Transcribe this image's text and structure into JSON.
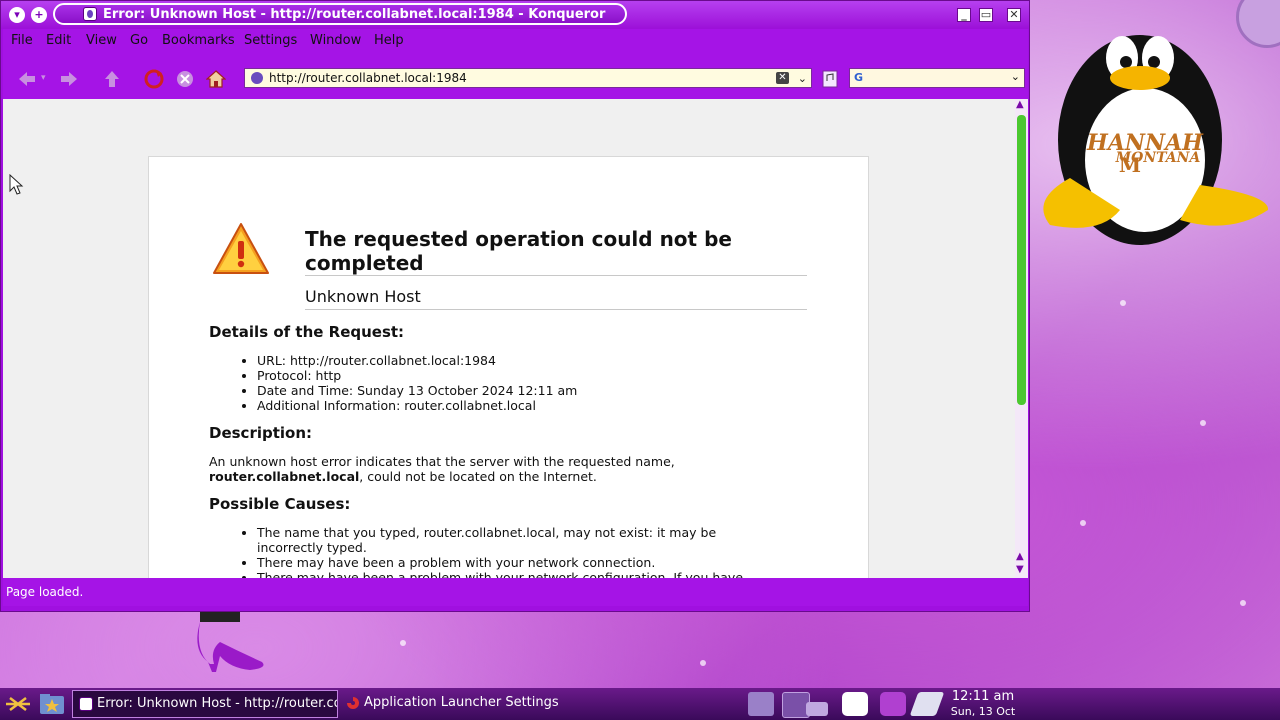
{
  "window": {
    "title": "Error: Unknown Host - http://router.collabnet.local:1984 - Konqueror"
  },
  "menubar": {
    "items": [
      "File",
      "Edit",
      "View",
      "Go",
      "Bookmarks",
      "Settings",
      "Window",
      "Help"
    ]
  },
  "toolbar": {
    "url": "http://router.collabnet.local:1984",
    "search_placeholder": ""
  },
  "page": {
    "heading": "The requested operation could not be completed",
    "subheading": "Unknown Host",
    "details_title": "Details of the Request:",
    "details": [
      "URL: http://router.collabnet.local:1984",
      "Protocol: http",
      "Date and Time: Sunday 13 October 2024 12:11 am",
      "Additional Information: router.collabnet.local"
    ],
    "description_title": "Description:",
    "description_pre": "An unknown host error indicates that the server with the requested name,",
    "description_host": "router.collabnet.local",
    "description_post": ", could not be located on the Internet.",
    "causes_title": "Possible Causes:",
    "causes": [
      "The name that you typed, router.collabnet.local, may not exist: it may be incorrectly typed.",
      "There may have been a problem with your network connection.",
      "There may have been a problem with your network configuration. If you have been"
    ]
  },
  "statusbar": {
    "text": "Page loaded."
  },
  "taskbar": {
    "tasks": [
      "Error: Unknown Host - http://router.co",
      "Application Launcher Settings"
    ],
    "clock_time": "12:11 am",
    "clock_date": "Sun, 13 Oct"
  },
  "colors": {
    "window_accent": "#a514e6",
    "scroll_thumb": "#4cc830",
    "url_bg": "#fffbe0"
  }
}
